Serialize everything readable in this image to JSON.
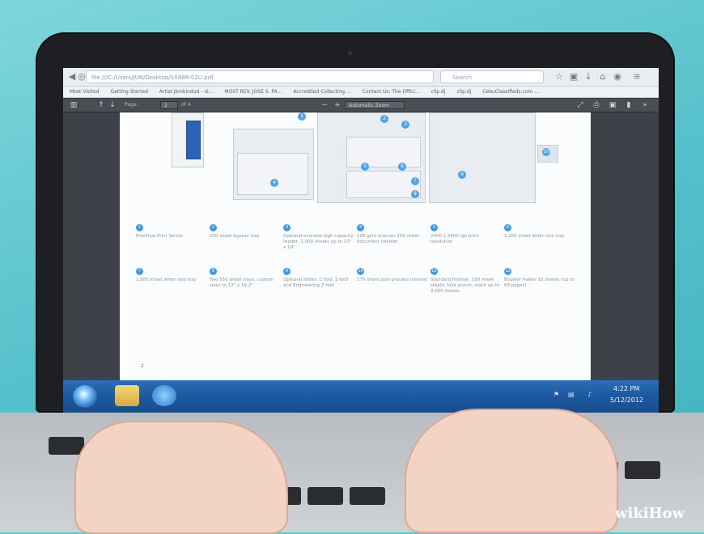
{
  "browser": {
    "url": "file:///C:/Users/JUN/Desktop/SX88R-02U.pdf",
    "search_placeholder": "Search",
    "bookmarks": [
      "Most Visited",
      "Getting Started",
      "Artist Jkmkindud - ol...",
      "MOST REV. JOSE S. PA...",
      "Accredited Collecting ...",
      "Contact Us: The Offici...",
      "clip.dj",
      "clip.dj",
      "CebuClassifieds.com ..."
    ]
  },
  "pdf_toolbar": {
    "page_label": "Page:",
    "page_value": "2",
    "page_total": "of 4",
    "zoom_value": "Automatic Zoom"
  },
  "pdf": {
    "page_number": "2",
    "features": [
      {
        "num": "1",
        "text": "FreeFlow Print Server"
      },
      {
        "num": "2",
        "text": "250 sheet bypass tray"
      },
      {
        "num": "3",
        "text": "Optional oversize high capacity feeder, 2,000 sheets up to 13\" x 19\""
      },
      {
        "num": "4",
        "text": "100 gsm scanner 250 sheet document handler"
      },
      {
        "num": "5",
        "text": "2400 x 2400 dpi print resolution"
      },
      {
        "num": "6",
        "text": "1,100 sheet letter size tray"
      },
      {
        "num": "7",
        "text": "1,600 sheet letter size tray"
      },
      {
        "num": "8",
        "text": "Two 550 sheet trays, custom sizes to 13\" x 19.2\""
      },
      {
        "num": "9",
        "text": "Optional folder: C-fold, Z-fold and Engineering Z-fold"
      },
      {
        "num": "10",
        "text": "175 sheet post-process inserter"
      },
      {
        "num": "11",
        "text": "Standard finisher, 100 sheet staple, hole punch, stack up to 3,000 sheets"
      },
      {
        "num": "12",
        "text": "Booklet maker 15 sheets (up to 60 pages)"
      }
    ],
    "markers": [
      "1",
      "2",
      "3",
      "4",
      "5",
      "6",
      "7",
      "8",
      "9",
      "10"
    ]
  },
  "taskbar": {
    "time": "4:22 PM",
    "date": "5/12/2012"
  },
  "watermark": "wikiHow",
  "colors": {
    "background": "#55c1ca",
    "taskbar": "#1d58a0",
    "marker": "#3c9be6"
  }
}
